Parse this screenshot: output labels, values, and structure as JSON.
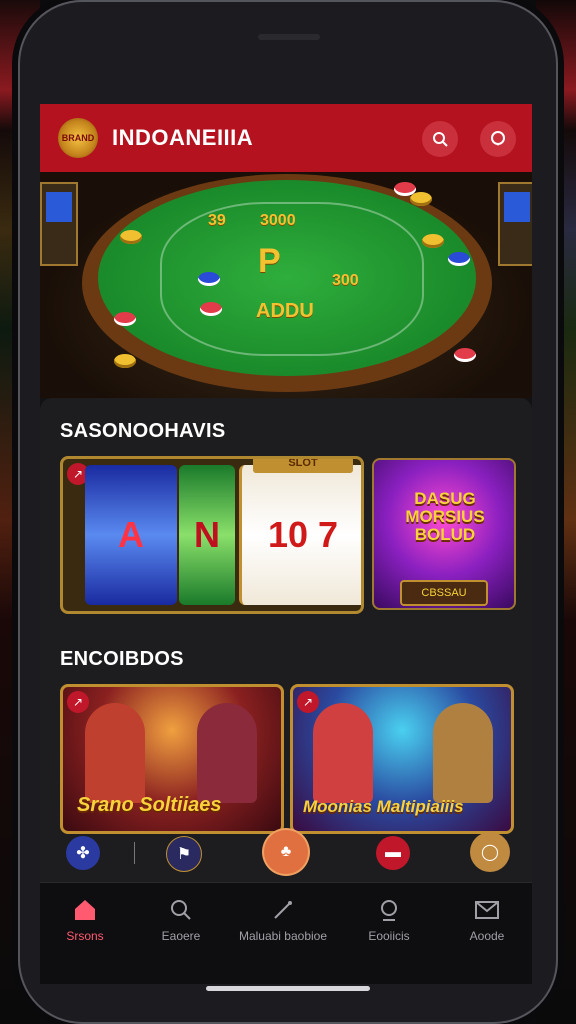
{
  "header": {
    "logo_text": "BRAND",
    "title": "INDOANEIIIA"
  },
  "hero": {
    "table_labels": [
      "39",
      "3000",
      "300",
      "ADDU"
    ]
  },
  "section1": {
    "title": "SASONOOHAVIS",
    "slot_card": {
      "reels": [
        "A",
        "N",
        "10 7"
      ],
      "top_label": "SLOT"
    },
    "bonus_card": {
      "text": "DASUG MORSIUS BOLUD",
      "button": "CBSSAU"
    }
  },
  "section2": {
    "title": "ENCOIBDOS",
    "cards": [
      {
        "label": "Srano Soltiiaes"
      },
      {
        "label": "Moonias Maltipiaiiis"
      }
    ]
  },
  "bottom_nav": {
    "items": [
      {
        "label": "Srsons",
        "icon": "home-icon"
      },
      {
        "label": "Eaoere",
        "icon": "search-icon"
      },
      {
        "label": "Maluabi baobioe",
        "icon": "dart-icon"
      },
      {
        "label": "Eooiicis",
        "icon": "location-icon"
      },
      {
        "label": "Aoode",
        "icon": "mail-icon"
      }
    ]
  },
  "colors": {
    "header": "#b4121f",
    "active_nav": "#ff5a70",
    "gold": "#f8d23a"
  }
}
